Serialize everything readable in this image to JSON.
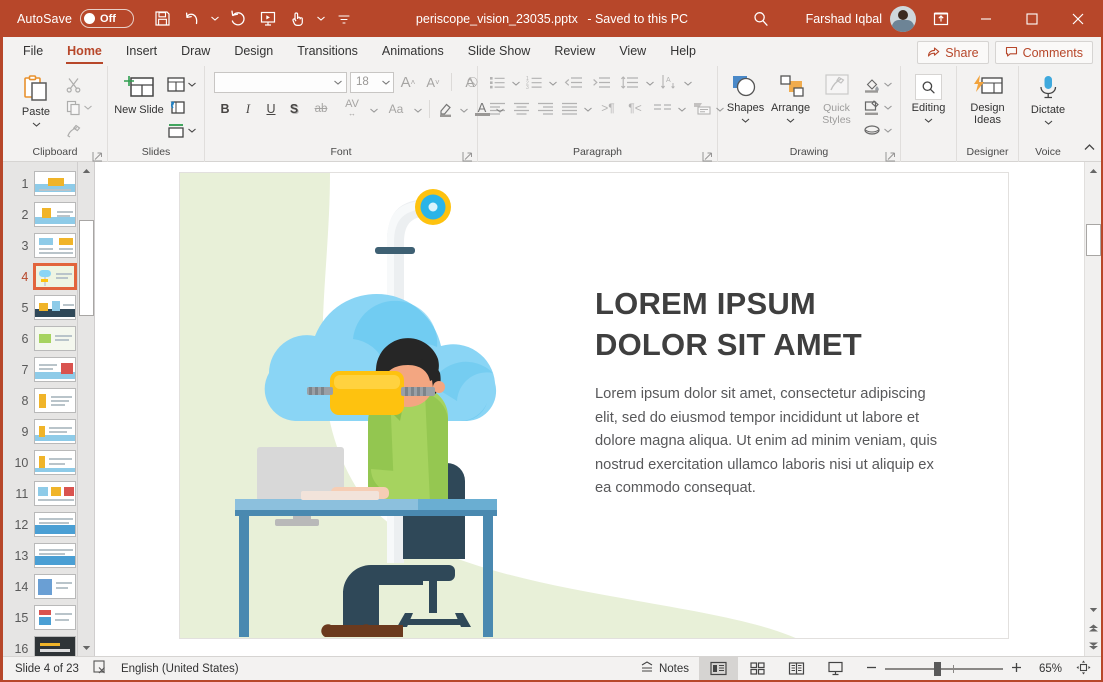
{
  "titlebar": {
    "autosave_label": "AutoSave",
    "autosave_state": "Off",
    "document_title": "periscope_vision_23035.pptx",
    "save_status": "-  Saved to this PC",
    "user_name": "Farshad Iqbal",
    "icons": {
      "save": "save-icon",
      "undo": "undo-icon",
      "redo": "redo-icon",
      "present": "start-presentation-icon",
      "touch": "touch-mode-icon",
      "more": "customize-qat-icon",
      "search": "search-icon",
      "ribbon_display": "ribbon-display-options-icon",
      "minimize": "minimize-icon",
      "maximize": "maximize-icon",
      "close": "close-icon"
    }
  },
  "tabs": [
    {
      "label": "File",
      "active": false
    },
    {
      "label": "Home",
      "active": true
    },
    {
      "label": "Insert",
      "active": false
    },
    {
      "label": "Draw",
      "active": false
    },
    {
      "label": "Design",
      "active": false
    },
    {
      "label": "Transitions",
      "active": false
    },
    {
      "label": "Animations",
      "active": false
    },
    {
      "label": "Slide Show",
      "active": false
    },
    {
      "label": "Review",
      "active": false
    },
    {
      "label": "View",
      "active": false
    },
    {
      "label": "Help",
      "active": false
    }
  ],
  "tab_actions": {
    "share_label": "Share",
    "comments_label": "Comments"
  },
  "ribbon": {
    "groups": [
      {
        "name": "Clipboard",
        "label": "Clipboard"
      },
      {
        "name": "Slides",
        "label": "Slides"
      },
      {
        "name": "Font",
        "label": "Font"
      },
      {
        "name": "Paragraph",
        "label": "Paragraph"
      },
      {
        "name": "Drawing",
        "label": "Drawing"
      },
      {
        "name": "Designer",
        "label": "Designer"
      },
      {
        "name": "Voice",
        "label": "Voice"
      }
    ],
    "clipboard": {
      "paste_label": "Paste",
      "cut_name": "cut-icon",
      "copy_name": "copy-icon",
      "format_painter_name": "format-painter-icon"
    },
    "slides": {
      "new_slide_label": "New Slide",
      "layout_name": "slide-layout-icon",
      "reset_name": "reset-slide-icon",
      "section_name": "section-icon"
    },
    "font": {
      "font_name_value": "",
      "font_name_placeholder": "",
      "font_size_value": "18",
      "grow_font": "grow-font-icon",
      "shrink_font": "shrink-font-icon",
      "clear_formatting": "clear-formatting-icon",
      "bold": "B",
      "italic": "I",
      "underline": "U",
      "shadow": "S",
      "strikethrough": "ab",
      "char_spacing": "AV",
      "change_case": "Aa",
      "text_highlight": "text-highlight-icon",
      "font_color": "A"
    },
    "paragraph": {
      "bullets": "bullets-icon",
      "numbering": "numbering-icon",
      "decrease_indent": "decrease-indent-icon",
      "increase_indent": "increase-indent-icon",
      "line_spacing": "line-spacing-icon",
      "align_left": "align-left-icon",
      "align_center": "align-center-icon",
      "align_right": "align-right-icon",
      "justify": "justify-icon",
      "columns": "columns-icon",
      "ltr": "left-to-right-icon",
      "rtl": "right-to-left-icon",
      "text_direction": "text-direction-icon",
      "align_text": "align-text-icon",
      "convert_smartart": "convert-to-smartart-icon"
    },
    "drawing": {
      "shapes_label": "Shapes",
      "arrange_label": "Arrange",
      "quick_styles_label": "Quick Styles",
      "shape_fill": "shape-fill-icon",
      "shape_outline": "shape-outline-icon",
      "shape_effects": "shape-effects-icon"
    },
    "editing": {
      "label": "Editing",
      "icon": "search-icon"
    },
    "designer": {
      "design_ideas_label": "Design Ideas",
      "icon": "design-ideas-icon"
    },
    "voice": {
      "dictate_label": "Dictate",
      "icon": "microphone-icon"
    },
    "collapse_icon": "collapse-ribbon-icon"
  },
  "thumbnails": {
    "selected": 4,
    "items": [
      {
        "number": "1"
      },
      {
        "number": "2"
      },
      {
        "number": "3"
      },
      {
        "number": "4"
      },
      {
        "number": "5"
      },
      {
        "number": "6"
      },
      {
        "number": "7"
      },
      {
        "number": "8"
      },
      {
        "number": "9"
      },
      {
        "number": "10"
      },
      {
        "number": "11"
      },
      {
        "number": "12"
      },
      {
        "number": "13"
      },
      {
        "number": "14"
      },
      {
        "number": "15"
      },
      {
        "number": "16"
      }
    ]
  },
  "slide": {
    "title": "LOREM IPSUM DOLOR SIT AMET",
    "title_line1": "LOREM IPSUM",
    "title_line2": "DOLOR SIT AMET",
    "body": "Lorem ipsum dolor sit amet, consectetur adipiscing elit, sed do eiusmod tempor incididunt ut labore et dolore magna aliqua. Ut enim ad minim veniam, quis nostrud exercitation ullamco laboris nisi ut aliquip ex ea commodo consequat.",
    "illustration_name": "vr-periscope-cloud-illustration",
    "colors": {
      "background_green": "#e8f0d8",
      "cloud": "#8ad5f5",
      "cloud_shade": "#5cc4ee",
      "periscope": "#eceff1",
      "lens_ring": "#fec20f",
      "lens": "#2ab4e8",
      "vr_headset": "#fec20f",
      "shirt": "#a6d35f",
      "pants": "#2f4858",
      "chair": "#2f4858",
      "desk": "#4a89b0",
      "desk_top": "#8cc0dd",
      "monitor": "#d8d8d8",
      "skin": "#f3a681",
      "hair": "#262626",
      "shoes": "#6b3a1e",
      "title_text": "#3f3f3f",
      "body_text": "#58585a"
    }
  },
  "statusbar": {
    "slide_indicator": "Slide 4 of 23",
    "accessibility_icon": "accessibility-check-icon",
    "language": "English (United States)",
    "notes_label": "Notes",
    "views": [
      {
        "name": "normal-view",
        "active": true
      },
      {
        "name": "slide-sorter-view",
        "active": false
      },
      {
        "name": "reading-view",
        "active": false
      },
      {
        "name": "slide-show-view",
        "active": false
      }
    ],
    "zoom_out": "zoom-out-icon",
    "zoom_in": "zoom-in-icon",
    "zoom_percent": "65%",
    "fit_slide": "fit-slide-to-window-icon"
  },
  "theme": {
    "accent": "#b7472a",
    "ribbon_bg": "#f3f2f1",
    "panel_bg": "#e6e5e4"
  }
}
